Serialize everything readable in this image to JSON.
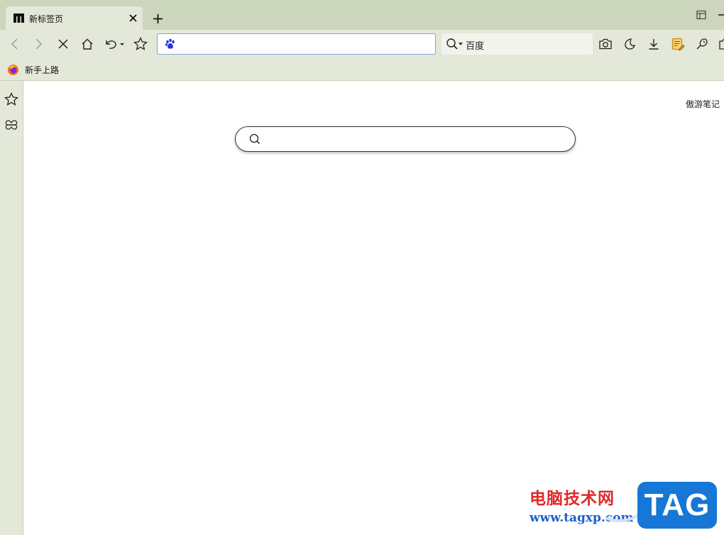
{
  "tabs": [
    {
      "title": "新标签页",
      "active": true
    }
  ],
  "toolbar": {
    "address_value": "",
    "address_placeholder": "",
    "search_engine": "百度"
  },
  "bookmarks": [
    {
      "label": "新手上路",
      "icon": "firefox-icon"
    }
  ],
  "content": {
    "note_link": "傲游笔记",
    "search_value": "",
    "search_placeholder": ""
  },
  "watermark": {
    "site_name": "电脑技术网",
    "site_url": "www.tagxp.com",
    "badge": "TAG"
  },
  "colors": {
    "tabstrip_bg": "#ccd6bd",
    "toolbar_bg": "#e3e8d8",
    "address_border": "#7ba2df",
    "watermark_red": "#e02828",
    "watermark_blue": "#1677d6"
  },
  "icons": {
    "tab_logo": "maxthon-logo-icon",
    "back": "chevron-left-icon",
    "forward": "chevron-right-icon",
    "stop": "close-icon",
    "home": "home-icon",
    "undo": "undo-icon",
    "favorite": "star-icon",
    "screenshot": "camera-icon",
    "night": "moon-icon",
    "download": "download-icon",
    "notes": "note-icon",
    "extension": "puzzle-icon"
  }
}
